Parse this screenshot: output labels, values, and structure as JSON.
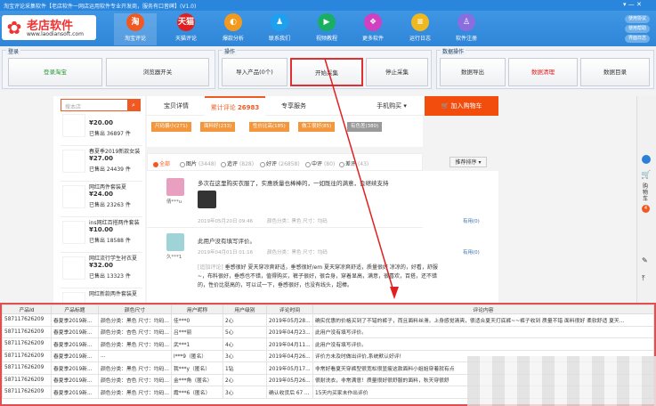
{
  "window": {
    "title": "淘宝评论采集软件【老店软件一网店运用软件专业开发商，服务有口皆碑】(V1.0)",
    "controls": "▾ — ✕"
  },
  "logo": {
    "mark": "✿",
    "name": "老店软件",
    "url": "www.laodiansoft.com"
  },
  "nav": [
    {
      "label": "淘宝评论",
      "icon": "taobao-icon",
      "glyph": "淘",
      "color": "#f05a22"
    },
    {
      "label": "天猫评论",
      "icon": "tmall-icon",
      "glyph": "天猫",
      "color": "#e02020"
    },
    {
      "label": "爆款分析",
      "icon": "chart-icon",
      "glyph": "◐",
      "color": "#f39a1e"
    },
    {
      "label": "联系我们",
      "icon": "qq-icon",
      "glyph": "♟",
      "color": "#1ea0f0"
    },
    {
      "label": "视频教程",
      "icon": "play-icon",
      "glyph": "▶",
      "color": "#18b060"
    },
    {
      "label": "更多软件",
      "icon": "gift-icon",
      "glyph": "❖",
      "color": "#d040c0"
    },
    {
      "label": "运行日志",
      "icon": "log-icon",
      "glyph": "≡",
      "color": "#f0b820"
    },
    {
      "label": "软件注册",
      "icon": "user-icon",
      "glyph": "♙",
      "color": "#8a6ee0"
    }
  ],
  "side_buttons": [
    "使用协议",
    "使用帮助",
    "界面日志"
  ],
  "toolbar": {
    "login": {
      "label": "登录",
      "buttons": [
        "登录淘宝",
        "浏览器开关"
      ]
    },
    "ops": {
      "label": "操作",
      "buttons": [
        "导入产品(0个)",
        "开始采集",
        "停止采集"
      ]
    },
    "data": {
      "label": "数据操作",
      "buttons": [
        "数据导出",
        "数据清理",
        "数据目录"
      ]
    }
  },
  "shop_search": {
    "placeholder": "搜本店",
    "icon": "search-icon"
  },
  "products": [
    {
      "name": "",
      "price": "¥20.00",
      "sold": "已售出 36897 件"
    },
    {
      "name": "春夏季2019新款女装",
      "price": "¥27.00",
      "sold": "已售出 24439 件"
    },
    {
      "name": "网红两件套装夏",
      "price": "¥24.00",
      "sold": "已售出 23263 件"
    },
    {
      "name": "ins网红百搭两件套装",
      "price": "¥10.00",
      "sold": "已售出 18588 件"
    },
    {
      "name": "网红流行学生衬衣夏",
      "price": "¥32.00",
      "sold": "已售出 13323 件"
    },
    {
      "name": "网红新款两件套装夏",
      "price": "",
      "sold": ""
    }
  ],
  "tabs": [
    {
      "label": "宝贝详情"
    },
    {
      "label": "累计评论",
      "count": "26983"
    },
    {
      "label": "专享服务"
    },
    {
      "label": "手机购买 ▾"
    }
  ],
  "cart_button": "加入购物车",
  "tags": [
    "尺码偏小(271)",
    "面料好(233)",
    "性价比高(185)",
    "做工很好(85)",
    "有色差(380)"
  ],
  "filters": [
    {
      "label": "全部",
      "count": "",
      "on": true
    },
    {
      "label": "图片",
      "count": "(3448)"
    },
    {
      "label": "追评",
      "count": "(828)"
    },
    {
      "label": "好评",
      "count": "(26858)"
    },
    {
      "label": "中评",
      "count": "(80)"
    },
    {
      "label": "差评",
      "count": "(43)"
    }
  ],
  "sort": "推荐排序 ▾",
  "reviews": [
    {
      "user": "倩***u",
      "text": "多次在这里购买衣服了，实惠质量也棒棒的，一如既往的满意，会继续支持",
      "date": "2019年05月20日 09:46",
      "sku": "颜色分类：黑色  尺寸：均码",
      "useful": "有用(0)"
    },
    {
      "user": "久***1",
      "text": "此用户没有填写评价。",
      "date": "2019年04月01日 01:16",
      "sku": "颜色分类：黑色  尺寸：均码",
      "useful": "有用(0)",
      "append_label": "[追加评论]",
      "append": [
        "垂感很好 夏天穿凉爽舒适，垂感很好/em 夏天穿凉爽舒适，质量很好 凉凉的，好看，舒服",
        "~，布料很好，垂感也不错，值得购买，裤子很好，很合身，穿着显高，满意，很喜欢，百搭，还不错",
        "的，性价比挺高的，可以试一下，垂感很好，也没有线头，超棒。"
      ]
    }
  ],
  "right_strip": {
    "cart_label": "购物车",
    "cart_count": "4"
  },
  "table": {
    "columns": [
      "产品Id",
      "产品标题",
      "颜色尺寸",
      "用户昵称",
      "用户级别",
      "评论时间",
      "评论内容"
    ],
    "rows": [
      [
        "587117626209",
        "春夏季2019新...",
        "颜色分类：黑色  尺寸：均码...",
        "佳***0",
        "2心",
        "2019年05月28...",
        "确实优惠的价格买到了不错的裤子，而且面料丝滑，上身感觉清爽，很适合夏天打底裤~~裤子收到 质量不错 面料很好 柔软舒适 夏天..."
      ],
      [
        "587117626209",
        "春夏季2019新...",
        "颜色分类：杏色  尺寸：均码...",
        "吕***丽",
        "5心",
        "2019年04月23...",
        "此用户没有填写评价。"
      ],
      [
        "587117626209",
        "春夏季2019新...",
        "颜色分类：黑色  尺寸：均码...",
        "武***1",
        "4心",
        "2019年04月11...",
        "此用户没有填写评价。"
      ],
      [
        "587117626209",
        "春夏季2019新...",
        "...",
        "l***9（匿名）",
        "3心",
        "2019年04月26...",
        "评价方未及时做出评价,系统默认好评!"
      ],
      [
        "587117626209",
        "春夏季2019新...",
        "颜色分类：黑色  尺寸：均码...",
        "我***y（匿名）",
        "1钻",
        "2019年05月17...",
        "非常好看夏天穿裤型很宽松很显瘦这款面料小姐姐穿着就有点"
      ],
      [
        "587117626209",
        "春夏季2019新...",
        "颜色分类：杏色  尺寸：均码...",
        "金***角（匿名）",
        "2心",
        "2019年05月26...",
        "很耐洗衣，非常满意！质量很好很舒服的面料，秋天穿很舒"
      ],
      [
        "587117626209",
        "春夏季2019新...",
        "颜色分类：黑色  尺寸：均码...",
        "霞***6（匿名）",
        "3心",
        "确认收货后 67 ...",
        "15天内买家未作出评价"
      ]
    ]
  },
  "colors": {
    "header": "#2f86d8",
    "accent": "#f05a22",
    "highlight": "#e03030"
  }
}
